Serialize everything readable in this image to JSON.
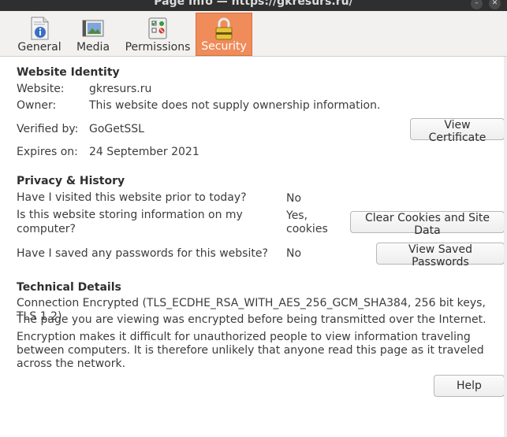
{
  "window": {
    "title": "Page Info — https://gkresurs.ru/"
  },
  "tabs": [
    {
      "label": "General",
      "icon": "info-page-icon"
    },
    {
      "label": "Media",
      "icon": "media-icon"
    },
    {
      "label": "Permissions",
      "icon": "permissions-icon"
    },
    {
      "label": "Security",
      "icon": "padlock-icon",
      "active": true
    }
  ],
  "identity": {
    "heading": "Website Identity",
    "website_label": "Website:",
    "website_value": "gkresurs.ru",
    "owner_label": "Owner:",
    "owner_value": "This website does not supply ownership information.",
    "verified_label": "Verified by:",
    "verified_value": "GoGetSSL",
    "expires_label": "Expires on:",
    "expires_value": "24 September 2021",
    "view_certificate": "View Certificate"
  },
  "privacy": {
    "heading": "Privacy & History",
    "q1": "Have I visited this website prior to today?",
    "a1": "No",
    "q2_line1": "Is this website storing information on my",
    "q2_line2": "computer?",
    "a2_line1": "Yes,",
    "a2_line2": "cookies",
    "clear_cookies": "Clear Cookies and Site Data",
    "q3": "Have I saved any passwords for this website?",
    "a3": "No",
    "view_passwords": "View Saved Passwords"
  },
  "technical": {
    "heading": "Technical Details",
    "line1": "Connection Encrypted (TLS_ECDHE_RSA_WITH_AES_256_GCM_SHA384, 256 bit keys, TLS 1.2)",
    "line2": "The page you are viewing was encrypted before being transmitted over the Internet.",
    "line3": "Encryption makes it difficult for unauthorized people to view information traveling between computers. It is therefore unlikely that anyone read this page as it traveled across the network."
  },
  "footer": {
    "help": "Help"
  },
  "colors": {
    "active_tab": "#ef8c5a",
    "titlebar": "#2f2f2f"
  }
}
